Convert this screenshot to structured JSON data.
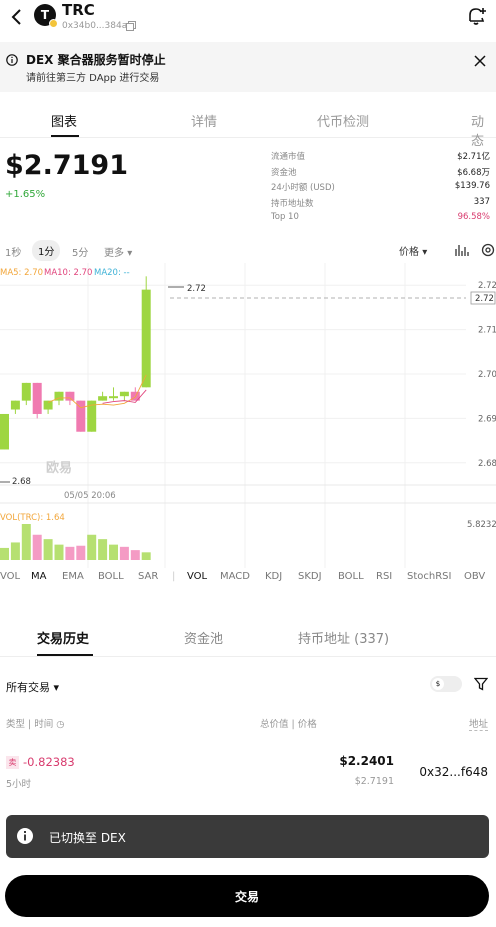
{
  "header": {
    "title": "TRC",
    "logo_letter": "T",
    "address": "0x34b0...384a"
  },
  "notice": {
    "title": "DEX 聚合器服务暂时停止",
    "subtitle": "请前往第三方 DApp 进行交易"
  },
  "tabs": [
    "图表",
    "详情",
    "代币检测",
    "动态"
  ],
  "price": {
    "value": "$2.7191",
    "change": "+1.65%"
  },
  "stats": [
    {
      "label": "流通市值",
      "value": "$2.71亿"
    },
    {
      "label": "资金池",
      "value": "$6.68万"
    },
    {
      "label": "24小时额 (USD)",
      "value": "$139.76"
    },
    {
      "label": "持币地址数",
      "value": "337"
    },
    {
      "label": "Top 10",
      "value": "96.58%"
    }
  ],
  "intervals": {
    "items": [
      "1秒",
      "1分",
      "5分"
    ],
    "more": "更多",
    "price_menu": "价格"
  },
  "chart": {
    "ma_labels": {
      "ma5": "MA5: 2.70",
      "ma10": "MA10: 2.70",
      "ma20": "MA20: --"
    },
    "y_ticks": [
      "2.72",
      "2.71",
      "2.70",
      "2.69",
      "2.68"
    ],
    "current_price_tag": "2.72",
    "high_label": "2.72",
    "low_label": "2.68",
    "x_label": "05/05 20:06",
    "watermark": "欧易",
    "vol_label": "VOL(TRC): 1.64",
    "vol_axis": "5.8232",
    "colors": {
      "up": "#9ed641",
      "down": "#f07ab0",
      "ma5": "#f2a63a",
      "ma10": "#e1457d",
      "ma20": "#3fb2d6"
    }
  },
  "chart_data": {
    "type": "candlestick",
    "ylim": [
      2.675,
      2.725
    ],
    "candles": [
      {
        "o": 2.683,
        "h": 2.691,
        "l": 2.683,
        "c": 2.691
      },
      {
        "o": 2.692,
        "h": 2.694,
        "l": 2.691,
        "c": 2.694
      },
      {
        "o": 2.694,
        "h": 2.698,
        "l": 2.693,
        "c": 2.698
      },
      {
        "o": 2.698,
        "h": 2.698,
        "l": 2.69,
        "c": 2.691
      },
      {
        "o": 2.692,
        "h": 2.694,
        "l": 2.691,
        "c": 2.694
      },
      {
        "o": 2.694,
        "h": 2.696,
        "l": 2.693,
        "c": 2.696
      },
      {
        "o": 2.696,
        "h": 2.696,
        "l": 2.693,
        "c": 2.694
      },
      {
        "o": 2.694,
        "h": 2.694,
        "l": 2.687,
        "c": 2.687
      },
      {
        "o": 2.687,
        "h": 2.694,
        "l": 2.687,
        "c": 2.694
      },
      {
        "o": 2.694,
        "h": 2.696,
        "l": 2.694,
        "c": 2.695
      },
      {
        "o": 2.695,
        "h": 2.697,
        "l": 2.694,
        "c": 2.695
      },
      {
        "o": 2.695,
        "h": 2.696,
        "l": 2.694,
        "c": 2.696
      },
      {
        "o": 2.696,
        "h": 2.697,
        "l": 2.694,
        "c": 2.694
      },
      {
        "o": 2.697,
        "h": 2.722,
        "l": 2.697,
        "c": 2.719
      }
    ],
    "volume": [
      0.55,
      0.8,
      1.64,
      1.15,
      0.95,
      0.7,
      0.6,
      0.65,
      1.15,
      0.95,
      0.7,
      0.6,
      0.45,
      0.35
    ],
    "volume_up": [
      true,
      true,
      true,
      false,
      true,
      true,
      false,
      false,
      true,
      true,
      true,
      false,
      false,
      true
    ]
  },
  "indicators": {
    "main": [
      "VOL",
      "MA",
      "EMA",
      "BOLL",
      "SAR"
    ],
    "sub": [
      "VOL",
      "MACD",
      "KDJ",
      "SKDJ",
      "BOLL",
      "RSI",
      "StochRSI",
      "OBV"
    ]
  },
  "bottom_tabs": [
    "交易历史",
    "资金池",
    "持币地址 (337)"
  ],
  "filter": {
    "label": "所有交易",
    "currency": "$"
  },
  "columns": {
    "type_time": "类型 | 时间",
    "value_price": "总价值 | 价格",
    "address": "地址"
  },
  "trades": [
    {
      "side": "卖",
      "amount": "-0.82383",
      "time": "5小时",
      "value": "$2.2401",
      "price": "$2.7191",
      "address": "0x32...f648"
    }
  ],
  "toast": {
    "text": "已切换至 DEX"
  },
  "trade_button": {
    "label": "交易"
  }
}
